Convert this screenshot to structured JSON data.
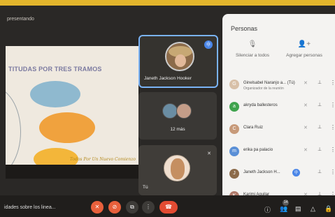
{
  "header": {
    "presenting_label": "presentando"
  },
  "slide": {
    "title": "TITUDAS POR TRES TRAMOS",
    "signature": "Todos Por Un Nuevo Comienzo"
  },
  "tiles": {
    "speaker_name": "Janeth Jackson Hooker",
    "others_label": "12 más",
    "self_label": "Tú"
  },
  "panel": {
    "title": "Personas",
    "mute_all": "Silenciar a todos",
    "add_people": "Agregar personas",
    "participants": [
      {
        "initial": "G",
        "name": "Ginelsabel Naranjo a... (Tú)",
        "role": "Organizador de la reunión",
        "color": "#d8c0a8"
      },
      {
        "initial": "a",
        "name": "akryda ballesteros",
        "role": "",
        "color": "#3fa34d"
      },
      {
        "initial": "C",
        "name": "Clara Ruiz",
        "role": "",
        "color": "#c79a7a"
      },
      {
        "initial": "m",
        "name": "erika pa palacio",
        "role": "",
        "color": "#5a8fd6"
      },
      {
        "initial": "J",
        "name": "Janeth Jackson H...",
        "role": "",
        "color": "#8c6b4a"
      },
      {
        "initial": "K",
        "name": "Karimi Aguilar",
        "role": "",
        "color": "#b07a6a"
      }
    ]
  },
  "bottom": {
    "meeting_name": "idades sobre los linea...",
    "people_count": "14"
  },
  "colors": {
    "accent_border": "#e2b52c",
    "mic_off_red": "#e8603c",
    "speaking_blue": "#4a86e8"
  }
}
